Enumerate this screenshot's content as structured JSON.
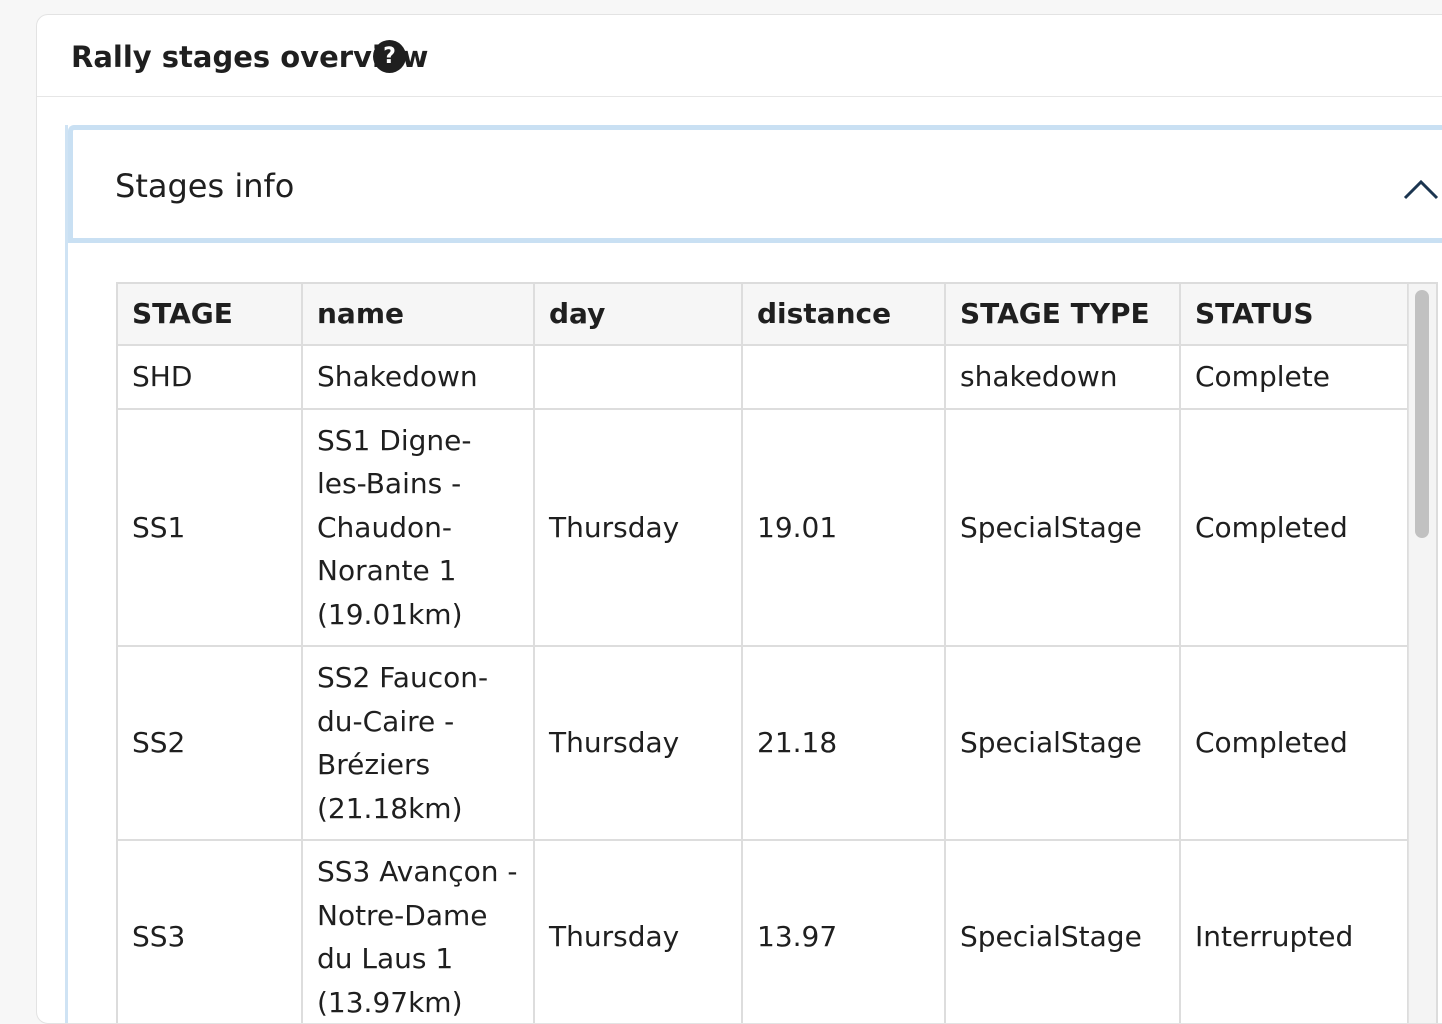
{
  "panel": {
    "title": "Rally stages overview",
    "help_icon_glyph": "?"
  },
  "accordion": {
    "title": "Stages info",
    "expanded": true,
    "toggle_icon": "chevron-up-icon"
  },
  "table": {
    "headers": [
      "STAGE",
      "name",
      "day",
      "distance",
      "STAGE TYPE",
      "STATUS"
    ],
    "rows": [
      [
        "SHD",
        "Shakedown",
        "",
        "",
        "shakedown",
        "Complete"
      ],
      [
        "SS1",
        "SS1 Digne-les-Bains - Chaudon-Norante 1 (19.01km)",
        "Thursday",
        "19.01",
        "SpecialStage",
        "Completed"
      ],
      [
        "SS2",
        "SS2 Faucon-du-Caire - Bréziers (21.18km)",
        "Thursday",
        "21.18",
        "SpecialStage",
        "Completed"
      ],
      [
        "SS3",
        "SS3 Avançon - Notre-Dame du Laus 1 (13.97km)",
        "Thursday",
        "13.97",
        "SpecialStage",
        "Interrupted"
      ]
    ]
  },
  "colors": {
    "accordion_border": "#c9e0f3",
    "header_bg": "#f6f6f6",
    "text": "#1f1f1f"
  }
}
